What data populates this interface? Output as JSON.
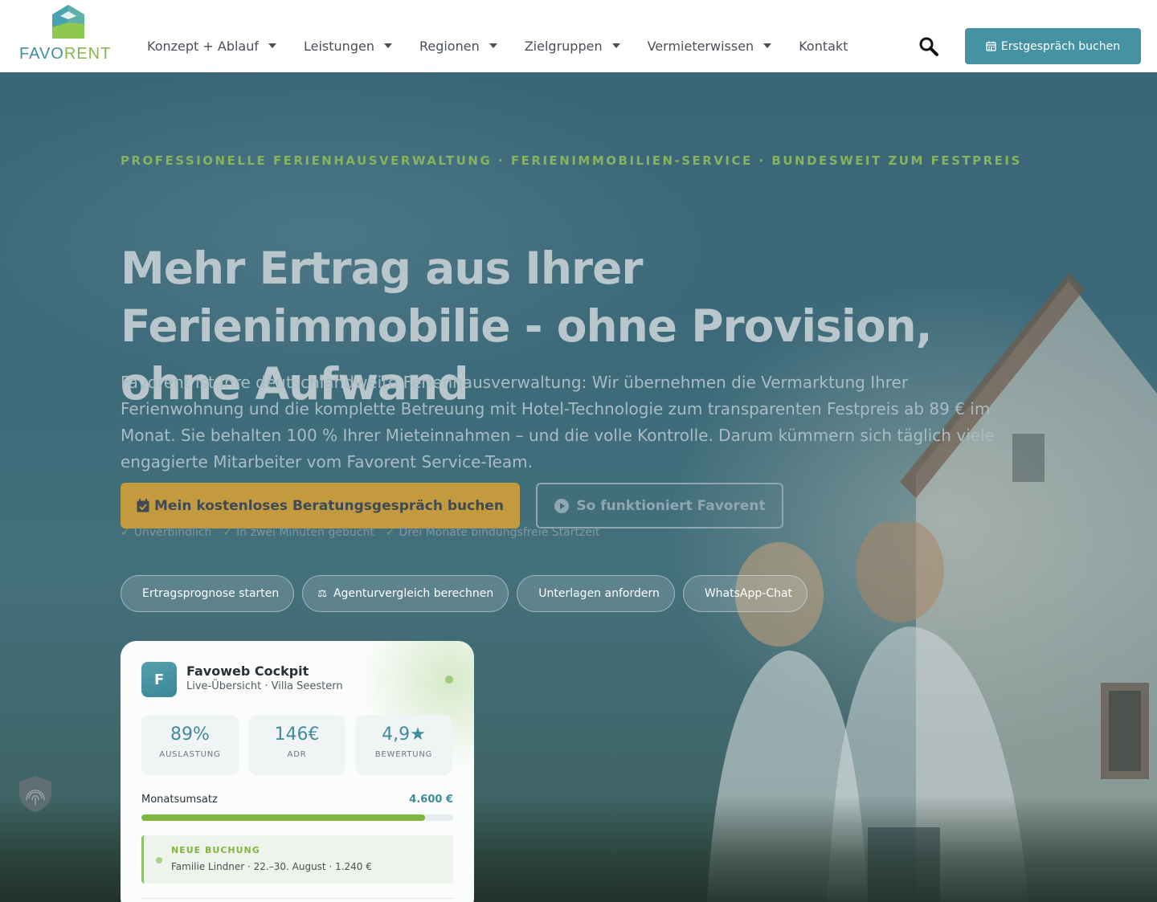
{
  "brand": {
    "logo_part1": "FAVO",
    "logo_part2": "RENT"
  },
  "nav": {
    "items": [
      {
        "label": "Konzept + Ablauf",
        "dropdown": true
      },
      {
        "label": "Leistungen",
        "dropdown": true
      },
      {
        "label": "Regionen",
        "dropdown": true
      },
      {
        "label": "Zielgruppen",
        "dropdown": true
      },
      {
        "label": "Vermieterwissen",
        "dropdown": true
      },
      {
        "label": "Kontakt",
        "dropdown": false
      }
    ],
    "search_icon": "search-icon",
    "cta_label": "Erstgespräch buchen",
    "cta_icon": "calendar-icon"
  },
  "hero": {
    "eyebrow": "PROFESSIONELLE FERIENHAUSVERWALTUNG · FERIENIMMOBILIEN-SERVICE · BUNDESWEIT ZUM FESTPREIS",
    "headline": "Mehr Ertrag aus Ihrer Ferienimmobilie - ohne Provision, ohne Aufwand",
    "lead": "Favorent ist Ihre deutschlandweite Ferienhausverwaltung: Wir übernehmen die Vermarktung Ihrer Ferienwohnung und die komplette Betreuung mit Hotel-Technologie zum transparenten Festpreis ab 89 € im Monat. Sie behalten 100 % Ihrer Mieteinnahmen – und die volle Kontrolle. Darum kümmern sich täglich viele engagierte Mitarbeiter vom Favorent Service-Team.",
    "primary_cta": "Mein kostenloses Beratungsgespräch buchen",
    "secondary_cta": "So funktioniert Favorent",
    "checks": [
      "Unverbindlich",
      "In zwei Minuten gebucht",
      "Drei Monate bindungsfreie Startzeit"
    ],
    "check_mark": "✓",
    "pills": [
      {
        "icon": "",
        "label": "Ertragsprognose starten"
      },
      {
        "icon": "⚖",
        "label": "Agenturvergleich berechnen"
      },
      {
        "icon": "",
        "label": "Unterlagen anfordern"
      },
      {
        "icon": "",
        "label": "WhatsApp-Chat"
      }
    ]
  },
  "cockpit": {
    "avatar_letter": "F",
    "title": "Favoweb Cockpit",
    "subtitle": "Live-Übersicht · Villa Seestern",
    "kpis": [
      {
        "value": "89%",
        "label": "AUSLASTUNG"
      },
      {
        "value": "146€",
        "label": "ADR"
      },
      {
        "value": "4,9★",
        "label": "BEWERTUNG"
      }
    ],
    "revenue_label": "Monatsumsatz",
    "revenue_value": "4.600 €",
    "revenue_progress": 0.91,
    "booking_tag": "NEUE BUCHUNG",
    "booking_text": "Familie Lindner · 22.–30. August · 1.240 €"
  },
  "colors": {
    "brand_teal": "#4592a2",
    "brand_green": "#86b84a",
    "cta_gold": "#c49a3e"
  }
}
